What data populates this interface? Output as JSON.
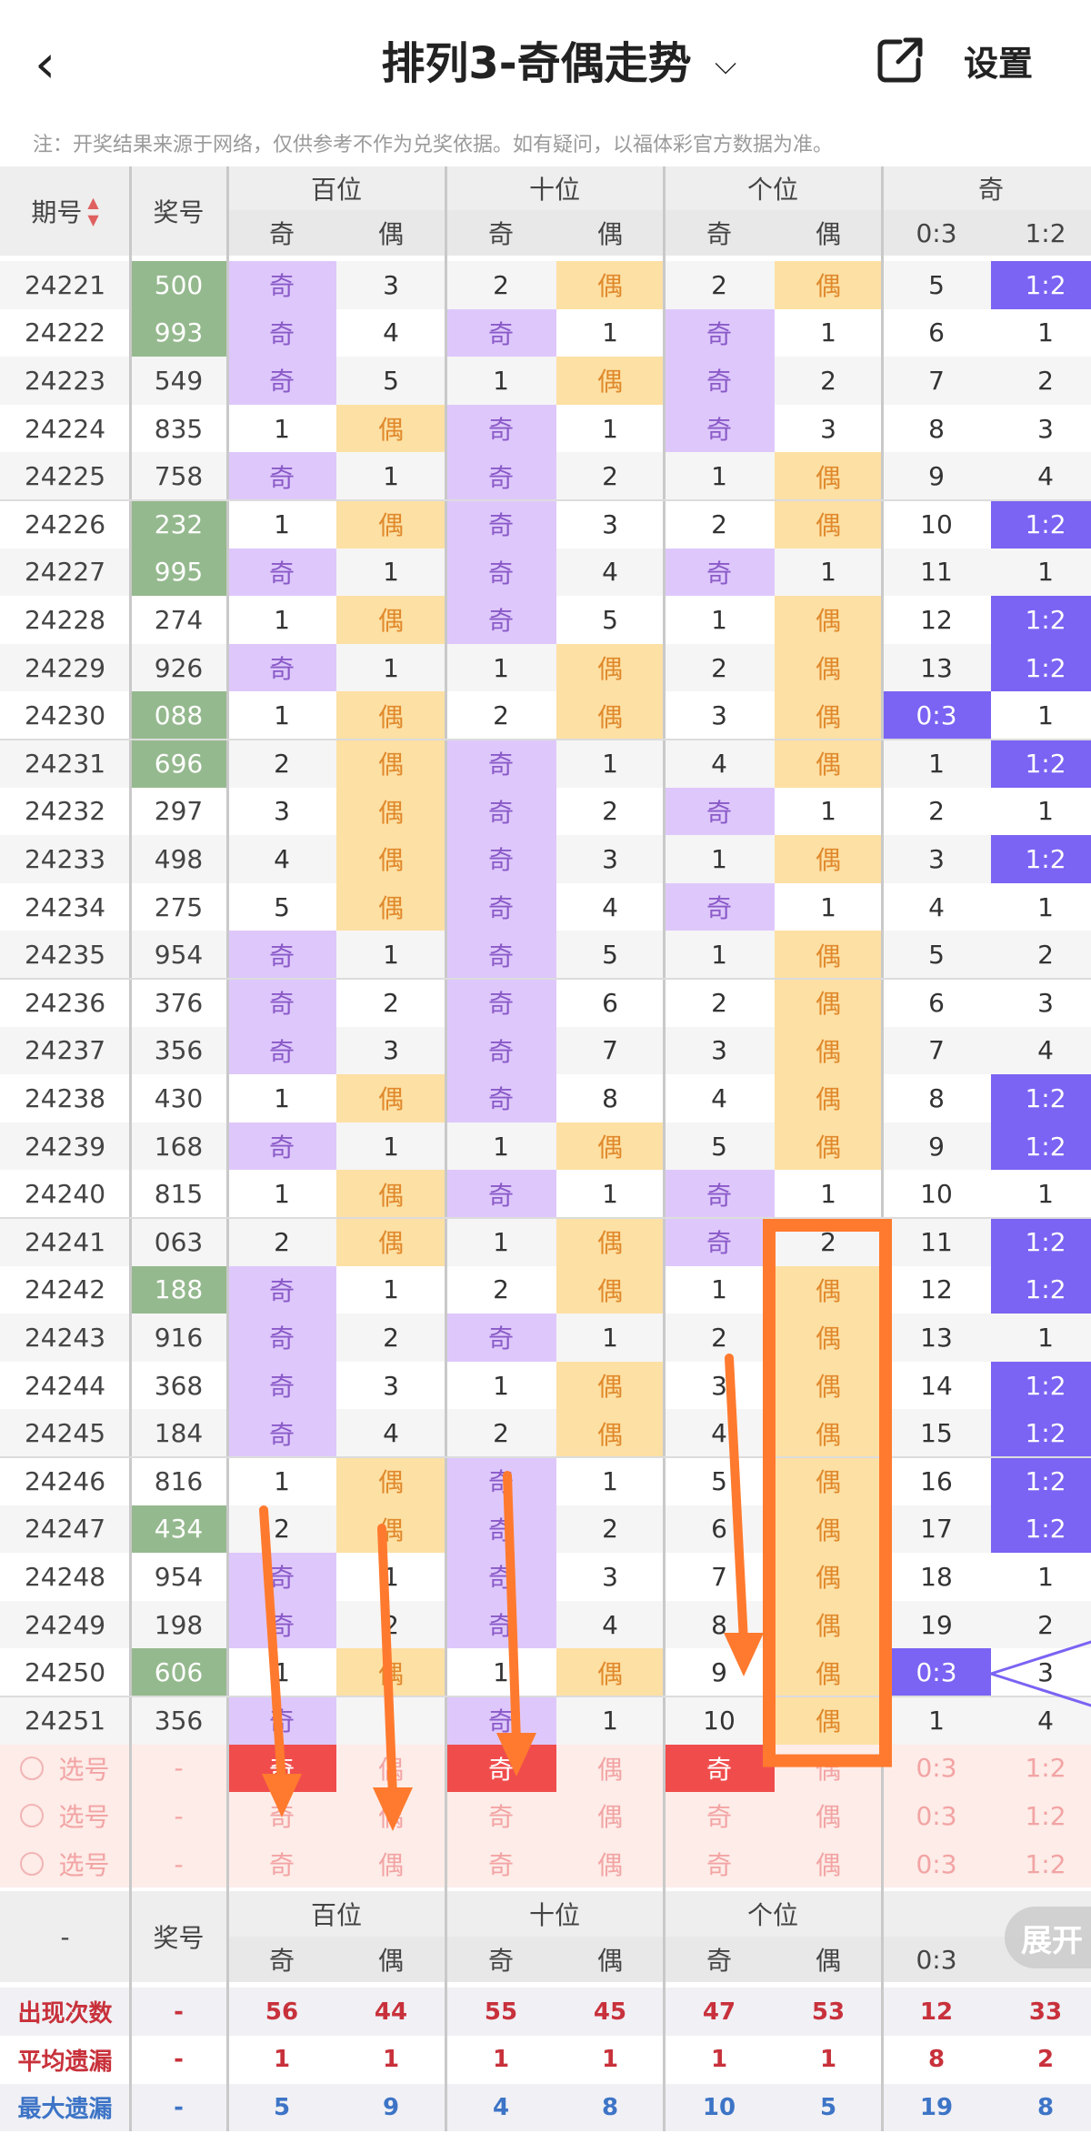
{
  "nav": {
    "back_icon": "chevron-left-icon",
    "title": "排列3-奇偶走势",
    "dropdown_icon": "chevron-down-icon",
    "share_icon": "share-external-icon",
    "settings_label": "设置"
  },
  "note": "注：开奖结果来源于网络，仅供参考不作为兑奖依据。如有疑问，以福体彩官方数据为准。",
  "headers": {
    "period": "期号",
    "award": "奖号",
    "groups": [
      "百位",
      "十位",
      "个位",
      "奇"
    ],
    "sub": [
      "奇",
      "偶",
      "奇",
      "偶",
      "奇",
      "偶",
      "0:3",
      "1:2"
    ]
  },
  "colors": {
    "odd": "#dec8fb",
    "even": "#fde0a4",
    "ratio": "#7b63f3",
    "award_highlight": "#95b98e",
    "annotation": "#ff7a2e",
    "pick_red": "#f04c4c"
  },
  "rows": [
    {
      "period": "24221",
      "award": "500",
      "hl": true,
      "c": [
        "奇",
        "3",
        "2",
        "偶",
        "2",
        "偶",
        "5",
        "1:2"
      ]
    },
    {
      "period": "24222",
      "award": "993",
      "hl": true,
      "c": [
        "奇",
        "4",
        "奇",
        "1",
        "奇",
        "1",
        "6",
        "1"
      ]
    },
    {
      "period": "24223",
      "award": "549",
      "hl": false,
      "c": [
        "奇",
        "5",
        "1",
        "偶",
        "奇",
        "2",
        "7",
        "2"
      ]
    },
    {
      "period": "24224",
      "award": "835",
      "hl": false,
      "c": [
        "1",
        "偶",
        "奇",
        "1",
        "奇",
        "3",
        "8",
        "3"
      ]
    },
    {
      "period": "24225",
      "award": "758",
      "hl": false,
      "c": [
        "奇",
        "1",
        "奇",
        "2",
        "1",
        "偶",
        "9",
        "4"
      ]
    },
    {
      "period": "24226",
      "award": "232",
      "hl": true,
      "c": [
        "1",
        "偶",
        "奇",
        "3",
        "2",
        "偶",
        "10",
        "1:2"
      ]
    },
    {
      "period": "24227",
      "award": "995",
      "hl": true,
      "c": [
        "奇",
        "1",
        "奇",
        "4",
        "奇",
        "1",
        "11",
        "1"
      ]
    },
    {
      "period": "24228",
      "award": "274",
      "hl": false,
      "c": [
        "1",
        "偶",
        "奇",
        "5",
        "1",
        "偶",
        "12",
        "1:2"
      ]
    },
    {
      "period": "24229",
      "award": "926",
      "hl": false,
      "c": [
        "奇",
        "1",
        "1",
        "偶",
        "2",
        "偶",
        "13",
        "1:2"
      ]
    },
    {
      "period": "24230",
      "award": "088",
      "hl": true,
      "c": [
        "1",
        "偶",
        "2",
        "偶",
        "3",
        "偶",
        "0:3",
        "1"
      ]
    },
    {
      "period": "24231",
      "award": "696",
      "hl": true,
      "c": [
        "2",
        "偶",
        "奇",
        "1",
        "4",
        "偶",
        "1",
        "1:2"
      ]
    },
    {
      "period": "24232",
      "award": "297",
      "hl": false,
      "c": [
        "3",
        "偶",
        "奇",
        "2",
        "奇",
        "1",
        "2",
        "1"
      ]
    },
    {
      "period": "24233",
      "award": "498",
      "hl": false,
      "c": [
        "4",
        "偶",
        "奇",
        "3",
        "1",
        "偶",
        "3",
        "1:2"
      ]
    },
    {
      "period": "24234",
      "award": "275",
      "hl": false,
      "c": [
        "5",
        "偶",
        "奇",
        "4",
        "奇",
        "1",
        "4",
        "1"
      ]
    },
    {
      "period": "24235",
      "award": "954",
      "hl": false,
      "c": [
        "奇",
        "1",
        "奇",
        "5",
        "1",
        "偶",
        "5",
        "2"
      ]
    },
    {
      "period": "24236",
      "award": "376",
      "hl": false,
      "c": [
        "奇",
        "2",
        "奇",
        "6",
        "2",
        "偶",
        "6",
        "3"
      ]
    },
    {
      "period": "24237",
      "award": "356",
      "hl": false,
      "c": [
        "奇",
        "3",
        "奇",
        "7",
        "3",
        "偶",
        "7",
        "4"
      ]
    },
    {
      "period": "24238",
      "award": "430",
      "hl": false,
      "c": [
        "1",
        "偶",
        "奇",
        "8",
        "4",
        "偶",
        "8",
        "1:2"
      ]
    },
    {
      "period": "24239",
      "award": "168",
      "hl": false,
      "c": [
        "奇",
        "1",
        "1",
        "偶",
        "5",
        "偶",
        "9",
        "1:2"
      ]
    },
    {
      "period": "24240",
      "award": "815",
      "hl": false,
      "c": [
        "1",
        "偶",
        "奇",
        "1",
        "奇",
        "1",
        "10",
        "1"
      ]
    },
    {
      "period": "24241",
      "award": "063",
      "hl": false,
      "c": [
        "2",
        "偶",
        "1",
        "偶",
        "奇",
        "2",
        "11",
        "1:2"
      ]
    },
    {
      "period": "24242",
      "award": "188",
      "hl": true,
      "c": [
        "奇",
        "1",
        "2",
        "偶",
        "1",
        "偶",
        "12",
        "1:2"
      ]
    },
    {
      "period": "24243",
      "award": "916",
      "hl": false,
      "c": [
        "奇",
        "2",
        "奇",
        "1",
        "2",
        "偶",
        "13",
        "1"
      ]
    },
    {
      "period": "24244",
      "award": "368",
      "hl": false,
      "c": [
        "奇",
        "3",
        "1",
        "偶",
        "3",
        "偶",
        "14",
        "1:2"
      ]
    },
    {
      "period": "24245",
      "award": "184",
      "hl": false,
      "c": [
        "奇",
        "4",
        "2",
        "偶",
        "4",
        "偶",
        "15",
        "1:2"
      ]
    },
    {
      "period": "24246",
      "award": "816",
      "hl": false,
      "c": [
        "1",
        "偶",
        "奇",
        "1",
        "5",
        "偶",
        "16",
        "1:2"
      ]
    },
    {
      "period": "24247",
      "award": "434",
      "hl": true,
      "c": [
        "2",
        "偶",
        "奇",
        "2",
        "6",
        "偶",
        "17",
        "1:2"
      ]
    },
    {
      "period": "24248",
      "award": "954",
      "hl": false,
      "c": [
        "奇",
        "1",
        "奇",
        "3",
        "7",
        "偶",
        "18",
        "1"
      ]
    },
    {
      "period": "24249",
      "award": "198",
      "hl": false,
      "c": [
        "奇",
        "2",
        "奇",
        "4",
        "8",
        "偶",
        "19",
        "2"
      ]
    },
    {
      "period": "24250",
      "award": "606",
      "hl": true,
      "c": [
        "1",
        "偶",
        "1",
        "偶",
        "9",
        "偶",
        "0:3",
        "3"
      ]
    },
    {
      "period": "24251",
      "award": "356",
      "hl": false,
      "c": [
        "奇",
        "",
        "奇",
        "1",
        "10",
        "偶",
        "1",
        "4"
      ]
    }
  ],
  "pick_rows": [
    {
      "label": "选号",
      "award": "-",
      "c": [
        "奇",
        "偶",
        "奇",
        "偶",
        "奇",
        "偶",
        "0:3",
        "1:2"
      ],
      "red": [
        0,
        2,
        4
      ]
    },
    {
      "label": "选号",
      "award": "-",
      "c": [
        "奇",
        "偶",
        "奇",
        "偶",
        "奇",
        "偶",
        "0:3",
        "1:2"
      ],
      "red": []
    },
    {
      "label": "选号",
      "award": "-",
      "c": [
        "奇",
        "偶",
        "奇",
        "偶",
        "奇",
        "偶",
        "0:3",
        "1:2"
      ],
      "red": []
    }
  ],
  "footer_header": {
    "period": "-",
    "award": "奖号",
    "groups": [
      "百位",
      "十位",
      "个位",
      ""
    ],
    "sub": [
      "奇",
      "偶",
      "奇",
      "偶",
      "奇",
      "偶",
      "0:3",
      ""
    ]
  },
  "stats": [
    {
      "label": "出现次数",
      "award": "-",
      "c": [
        "56",
        "44",
        "55",
        "45",
        "47",
        "53",
        "12",
        "33"
      ],
      "color": "red"
    },
    {
      "label": "平均遗漏",
      "award": "-",
      "c": [
        "1",
        "1",
        "1",
        "1",
        "1",
        "1",
        "8",
        "2"
      ],
      "color": "red"
    },
    {
      "label": "最大遗漏",
      "award": "-",
      "c": [
        "5",
        "9",
        "4",
        "8",
        "10",
        "5",
        "19",
        "8"
      ],
      "color": "blue"
    }
  ],
  "expand_label": "展开"
}
